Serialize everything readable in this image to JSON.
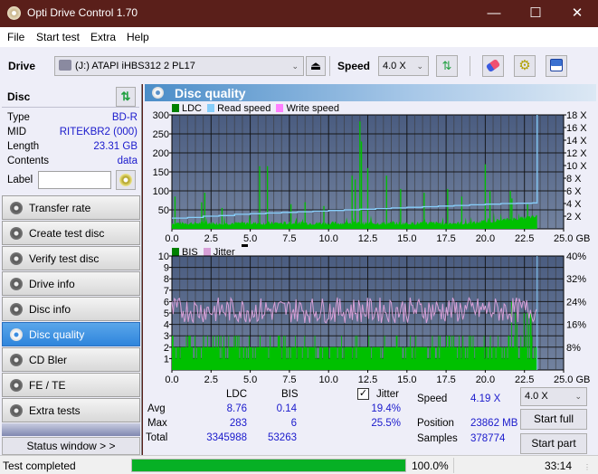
{
  "window": {
    "title": "Opti Drive Control 1.70",
    "minimize": "—",
    "maximize": "☐",
    "close": "✕"
  },
  "menu": [
    "File",
    "Start test",
    "Extra",
    "Help"
  ],
  "toolbar": {
    "drive_label": "Drive",
    "drive_value": "(J:)  ATAPI iHBS312  2 PL17",
    "speed_label": "Speed",
    "speed_value": "4.0 X",
    "icons": [
      "drive-icon",
      "eject-icon",
      "refresh-icon",
      "erase-icon",
      "settings-icon",
      "save-icon"
    ]
  },
  "disc": {
    "header": "Disc",
    "type_label": "Type",
    "type_value": "BD-R",
    "mid_label": "MID",
    "mid_value": "RITEKBR2 (000)",
    "length_label": "Length",
    "length_value": "23.31 GB",
    "contents_label": "Contents",
    "contents_value": "data",
    "label_label": "Label",
    "label_value": ""
  },
  "nav": [
    {
      "label": "Transfer rate",
      "active": false
    },
    {
      "label": "Create test disc",
      "active": false
    },
    {
      "label": "Verify test disc",
      "active": false
    },
    {
      "label": "Drive info",
      "active": false
    },
    {
      "label": "Disc info",
      "active": false
    },
    {
      "label": "Disc quality",
      "active": true
    },
    {
      "label": "CD Bler",
      "active": false
    },
    {
      "label": "FE / TE",
      "active": false
    },
    {
      "label": "Extra tests",
      "active": false
    }
  ],
  "status_window_label": "Status window > >",
  "statusbar": {
    "text": "Test completed",
    "progress_percent": 100.0,
    "progress_label": "100.0%",
    "time": "33:14"
  },
  "panel_title": "Disc quality",
  "colors": {
    "ldc": "#00c000",
    "read_speed": "#87cefa",
    "write_speed": "#ff80ff",
    "bis": "#00c000",
    "jitter": "#d8a0d8",
    "legend_ldc": "#008000",
    "progress": "#06b025"
  },
  "chart_data": [
    {
      "type": "bar",
      "title": "LDC / Read speed",
      "legend": [
        "LDC",
        "Read speed",
        "Write speed"
      ],
      "xlabel": "GB",
      "x_ticks": [
        "0.0",
        "2.5",
        "5.0",
        "7.5",
        "10.0",
        "12.5",
        "15.0",
        "17.5",
        "20.0",
        "22.5",
        "25.0 GB"
      ],
      "xlim": [
        0,
        25
      ],
      "y_ticks": [
        "300",
        "250",
        "200",
        "150",
        "100",
        "50"
      ],
      "ylim": [
        0,
        300
      ],
      "y2_ticks": [
        "18 X",
        "16 X",
        "14 X",
        "12 X",
        "10 X",
        "8 X",
        "6 X",
        "4 X",
        "2 X"
      ],
      "y2lim": [
        0,
        18
      ],
      "ldc_baseline": 15,
      "ldc_spikes": [
        [
          0.2,
          85
        ],
        [
          1.9,
          70
        ],
        [
          2.1,
          95
        ],
        [
          3.2,
          55
        ],
        [
          5.6,
          165
        ],
        [
          6.1,
          165
        ],
        [
          7.6,
          65
        ],
        [
          8.5,
          70
        ],
        [
          9.7,
          60
        ],
        [
          11.5,
          140
        ],
        [
          11.7,
          130
        ],
        [
          12.0,
          283
        ],
        [
          12.1,
          230
        ],
        [
          12.5,
          160
        ],
        [
          13.7,
          140
        ],
        [
          14.6,
          105
        ],
        [
          16.1,
          95
        ],
        [
          17.6,
          105
        ],
        [
          18.5,
          85
        ],
        [
          20.0,
          170
        ],
        [
          20.3,
          100
        ],
        [
          21.6,
          100
        ],
        [
          21.7,
          80
        ],
        [
          22.7,
          65
        ]
      ],
      "read_speed_x": [
        0.0,
        1.0,
        2.0,
        3.0,
        4.0,
        5.0,
        6.0,
        7.0,
        8.0,
        9.0,
        10.0,
        11.0,
        12.0,
        13.0,
        14.0,
        15.0,
        16.0,
        17.0,
        18.0,
        19.0,
        20.0,
        21.0,
        22.0,
        23.0,
        23.31
      ],
      "read_speed_y": [
        1.7,
        1.8,
        2.0,
        2.1,
        2.3,
        2.4,
        2.5,
        2.6,
        2.7,
        2.8,
        2.9,
        3.0,
        3.1,
        3.2,
        3.3,
        3.4,
        3.5,
        3.6,
        3.7,
        3.8,
        3.9,
        4.0,
        4.05,
        4.1,
        4.19
      ]
    },
    {
      "type": "bar",
      "title": "BIS / Jitter",
      "legend": [
        "BIS",
        "Jitter"
      ],
      "xlabel": "GB",
      "x_ticks": [
        "0.0",
        "2.5",
        "5.0",
        "7.5",
        "10.0",
        "12.5",
        "15.0",
        "17.5",
        "20.0",
        "22.5",
        "25.0 GB"
      ],
      "xlim": [
        0,
        25
      ],
      "y_ticks": [
        "10",
        "9",
        "8",
        "7",
        "6",
        "5",
        "4",
        "3",
        "2",
        "1"
      ],
      "ylim": [
        0,
        10
      ],
      "y2_ticks": [
        "40%",
        "32%",
        "24%",
        "16%",
        "8%"
      ],
      "y2lim": [
        0,
        40
      ],
      "bis_typical": 2,
      "bis_max": 6,
      "jitter_range_percent": [
        16,
        25.5
      ],
      "jitter_avg_percent": 19.4
    }
  ],
  "stats": {
    "col_ldc": "LDC",
    "col_bis": "BIS",
    "jitter_label": "Jitter",
    "jitter_checked": true,
    "avg_label": "Avg",
    "max_label": "Max",
    "total_label": "Total",
    "avg_ldc": "8.76",
    "avg_bis": "0.14",
    "avg_jitter": "19.4%",
    "max_ldc": "283",
    "max_bis": "6",
    "max_jitter": "25.5%",
    "total_ldc": "3345988",
    "total_bis": "53263",
    "speed_label": "Speed",
    "speed_value": "4.19 X",
    "position_label": "Position",
    "position_value": "23862 MB",
    "samples_label": "Samples",
    "samples_value": "378774",
    "speed_select": "4.0 X",
    "start_full": "Start full",
    "start_part": "Start part"
  }
}
